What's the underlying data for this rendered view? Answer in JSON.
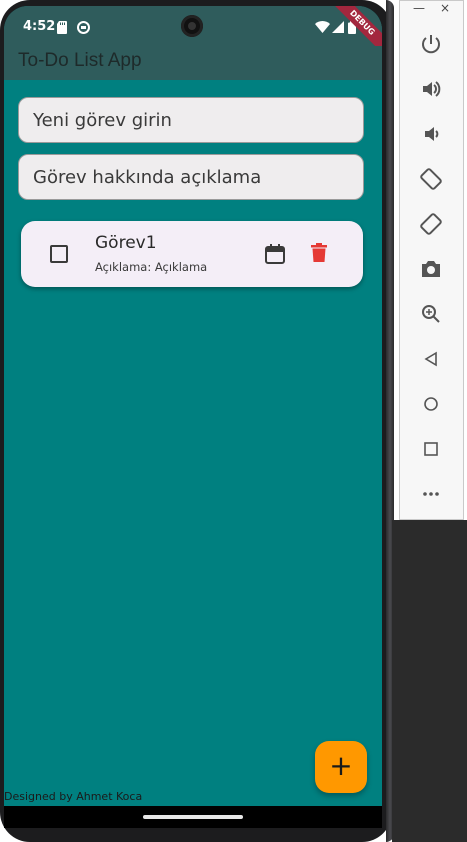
{
  "status_bar": {
    "time": "4:52",
    "debug_banner": "DEBUG",
    "icons": [
      "sd-card-icon",
      "sync-icon",
      "wifi-icon",
      "signal-icon",
      "battery-icon"
    ]
  },
  "app_bar": {
    "title": "To-Do List App"
  },
  "inputs": {
    "task_title_placeholder": "Yeni görev girin",
    "task_desc_placeholder": "Görev hakkında açıklama"
  },
  "tasks": [
    {
      "title": "Görev1",
      "description": "Açıklama: Açıklama",
      "checked": false
    }
  ],
  "fab": {
    "label": "+"
  },
  "footer": {
    "text": "Designed by Ahmet Koca"
  },
  "emulator_toolbar": {
    "window_controls": [
      "—",
      "×"
    ],
    "buttons": [
      "power-icon",
      "volume-up-icon",
      "volume-down-icon",
      "rotate-left-icon",
      "rotate-right-icon",
      "camera-icon",
      "zoom-icon",
      "back-icon",
      "home-icon",
      "overview-icon",
      "more-icon"
    ]
  },
  "colors": {
    "app_background": "#008080",
    "app_bar": "#2f5c5c",
    "card": "#f4eef7",
    "fab": "#ff9800",
    "delete": "#e53935"
  }
}
